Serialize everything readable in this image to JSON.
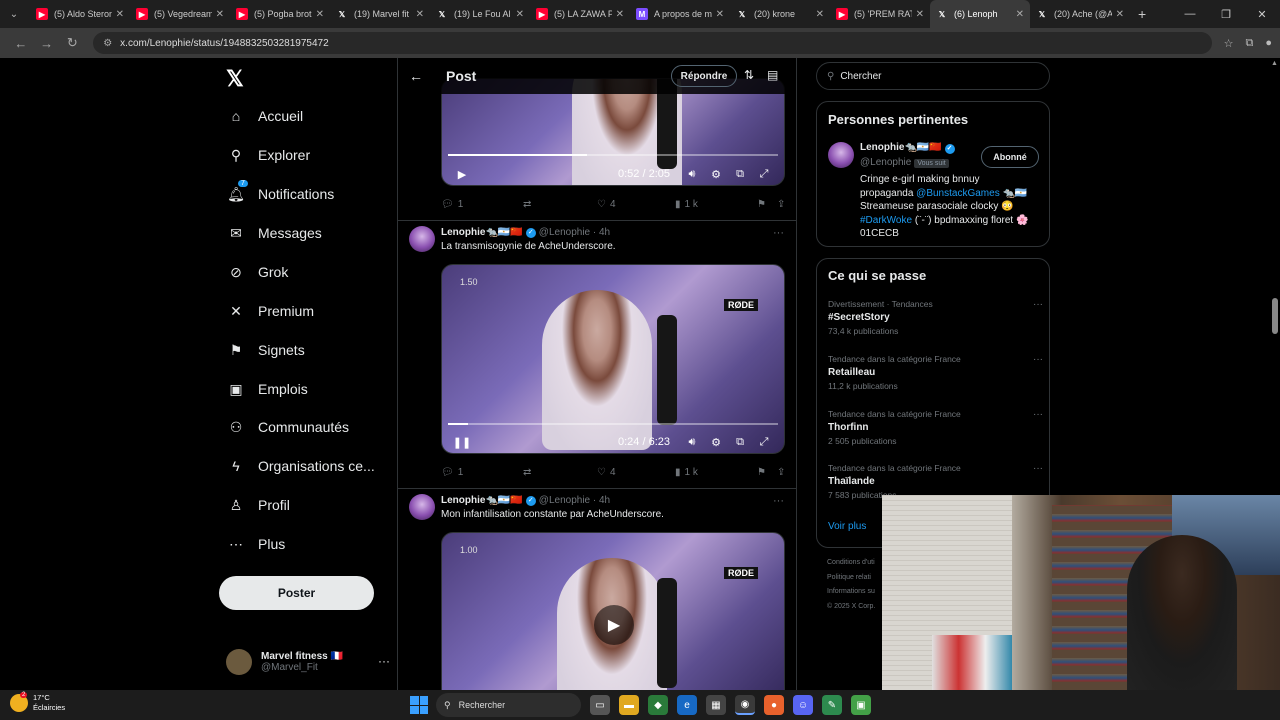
{
  "browser": {
    "tabs": [
      {
        "title": "(5) Aldo Steron",
        "icon": "youtube-icon",
        "active": false
      },
      {
        "title": "(5) Vegedream",
        "icon": "youtube-icon",
        "active": false
      },
      {
        "title": "(5) Pogba brot",
        "icon": "youtube-icon",
        "active": false
      },
      {
        "title": "(19) Marvel fit",
        "icon": "x-icon",
        "active": false
      },
      {
        "title": "(19) Le Fou Al",
        "icon": "x-icon",
        "active": false
      },
      {
        "title": "(5) LA ZAWA P",
        "icon": "youtube-icon",
        "active": false
      },
      {
        "title": "A propos de m",
        "icon": "page-icon",
        "active": false
      },
      {
        "title": "(20) krone",
        "icon": "x-icon",
        "active": false
      },
      {
        "title": "(5) 'PREM RAT",
        "icon": "youtube-icon",
        "active": false
      },
      {
        "title": "(6) Lenoph",
        "icon": "x-icon",
        "active": true
      },
      {
        "title": "(20) Ache (@A",
        "icon": "x-icon",
        "active": false
      }
    ],
    "url": "x.com/Lenophie/status/1948832503281975472"
  },
  "nav": {
    "logo": "𝕏",
    "items": [
      {
        "label": "Accueil",
        "icon": "home-icon",
        "glyph": "⌂"
      },
      {
        "label": "Explorer",
        "icon": "search-icon",
        "glyph": "⚲"
      },
      {
        "label": "Notifications",
        "icon": "bell-icon",
        "glyph": "🔔︎",
        "badge": "7"
      },
      {
        "label": "Messages",
        "icon": "envelope-icon",
        "glyph": "✉"
      },
      {
        "label": "Grok",
        "icon": "grok-icon",
        "glyph": "⊘"
      },
      {
        "label": "Premium",
        "icon": "x-premium-icon",
        "glyph": "✕"
      },
      {
        "label": "Signets",
        "icon": "bookmark-icon",
        "glyph": "⚑"
      },
      {
        "label": "Emplois",
        "icon": "briefcase-icon",
        "glyph": "▣"
      },
      {
        "label": "Communautés",
        "icon": "communities-icon",
        "glyph": "⚇"
      },
      {
        "label": "Organisations ce...",
        "icon": "lightning-icon",
        "glyph": "ϟ"
      },
      {
        "label": "Profil",
        "icon": "profile-icon",
        "glyph": "♙"
      },
      {
        "label": "Plus",
        "icon": "more-circle-icon",
        "glyph": "⋯"
      }
    ],
    "post_button": "Poster",
    "account": {
      "name": "Marvel fitness 🇫🇷",
      "handle": "@Marvel_Fit"
    }
  },
  "main": {
    "header_title": "Post",
    "reply_button": "Répondre",
    "video1": {
      "time": "0:52 / 2:05",
      "progress": 0.42
    },
    "video1_actions": {
      "replies": "1",
      "likes": "4",
      "views": "1 k"
    },
    "tweet2": {
      "name": "Lenophie🐀🇦🇷🇨🇳",
      "handle": "@Lenophie · 4h",
      "text": "La transmisogynie de AcheUnderscore.",
      "speed": "1.50",
      "time": "0:24 / 6:23",
      "progress": 0.06,
      "replies": "1",
      "likes": "4",
      "views": "1 k"
    },
    "tweet3": {
      "name": "Lenophie🐀🇦🇷🇨🇳",
      "handle": "@Lenophie · 4h",
      "text": "Mon infantilisation constante par AcheUnderscore.",
      "speed": "1.00"
    }
  },
  "sidebar": {
    "search_placeholder": "Chercher",
    "relevant": {
      "title": "Personnes pertinentes",
      "name": "Lenophie🐀🇦🇷🇨🇳",
      "handle": "@Lenophie",
      "follows_you": "Vous suit",
      "follow_button": "Abonné",
      "bio_1": "Cringe e-girl making bnnuy",
      "bio_2a": "propaganda ",
      "bio_2_link": "@BunstackGames",
      "bio_2b": " 🐀🇦🇷",
      "bio_3": "Streameuse parasociale clocky 😳",
      "bio_4_link": "#DarkWoke",
      "bio_4b": " (¨-¨) bpdmaxxing floret 🌸",
      "bio_5": "01CECB"
    },
    "happening": {
      "title": "Ce qui se passe",
      "trends": [
        {
          "context": "Divertissement · Tendances",
          "name": "#SecretStory",
          "posts": "73,4 k publications"
        },
        {
          "context": "Tendance dans la catégorie France",
          "name": "Retailleau",
          "posts": "11,2 k publications"
        },
        {
          "context": "Tendance dans la catégorie France",
          "name": "Thorfinn",
          "posts": "2 505 publications"
        },
        {
          "context": "Tendance dans la catégorie France",
          "name": "Thaïlande",
          "posts": "7 583 publications"
        }
      ],
      "see_more": "Voir plus"
    },
    "footer": [
      "Conditions d'uti",
      "Politique relati",
      "Informations su",
      "© 2025 X Corp."
    ]
  },
  "taskbar": {
    "weather_temp": "17°C",
    "weather_desc": "Éclaircies",
    "weather_badge": "2",
    "search": "Rechercher"
  }
}
